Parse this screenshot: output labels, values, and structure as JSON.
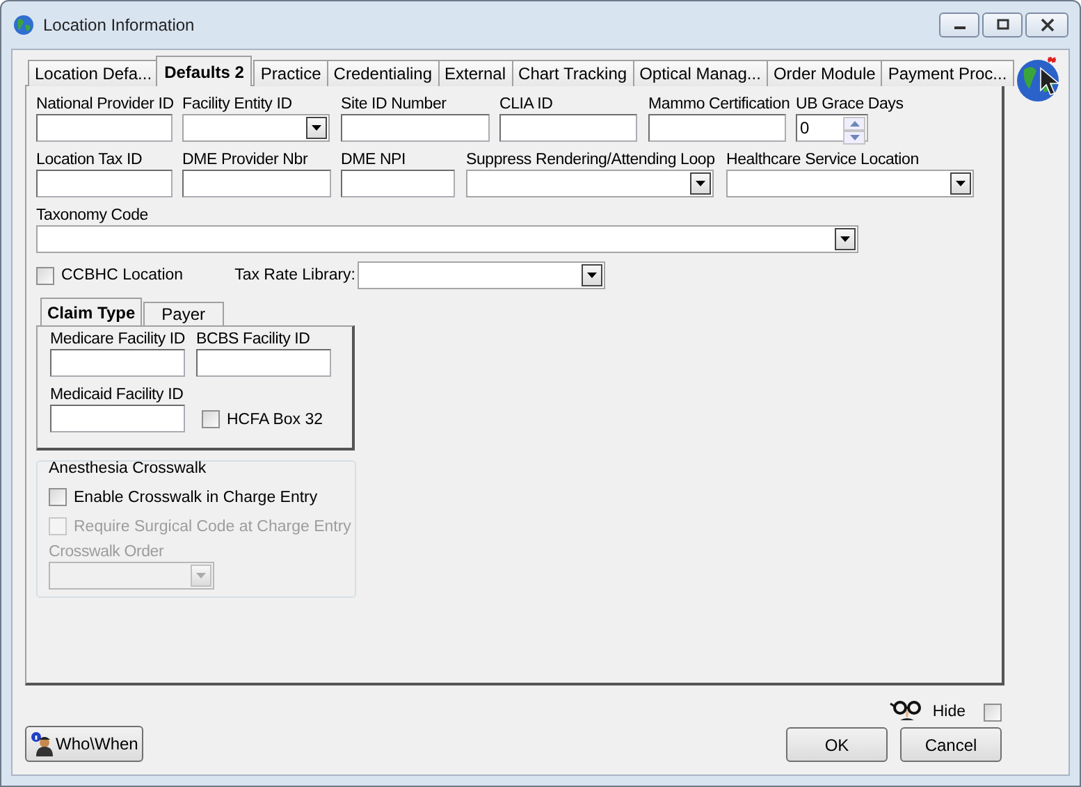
{
  "window": {
    "title": "Location Information"
  },
  "tabs": [
    {
      "label": "Location Defa...",
      "selected": false
    },
    {
      "label": "Defaults 2",
      "selected": true
    },
    {
      "label": "Practice",
      "selected": false
    },
    {
      "label": "Credentialing",
      "selected": false
    },
    {
      "label": "External",
      "selected": false
    },
    {
      "label": "Chart Tracking",
      "selected": false
    },
    {
      "label": "Optical Manag...",
      "selected": false
    },
    {
      "label": "Order Module",
      "selected": false
    },
    {
      "label": "Payment Proc...",
      "selected": false
    }
  ],
  "rows": [
    [
      {
        "kind": "text",
        "label": "National Provider ID"
      },
      {
        "kind": "combo",
        "label": "Facility Entity ID"
      },
      {
        "kind": "text",
        "label": "Site ID Number"
      },
      {
        "kind": "text",
        "label": "CLIA ID"
      },
      {
        "kind": "text",
        "label": "Mammo Certification"
      },
      {
        "kind": "spinner",
        "label": "UB Grace Days",
        "value": "0"
      }
    ],
    [
      {
        "kind": "text",
        "label": "Location Tax ID"
      },
      {
        "kind": "text",
        "label": "DME Provider Nbr"
      },
      {
        "kind": "text",
        "label": "DME NPI"
      },
      {
        "kind": "combo",
        "label": "Suppress Rendering/Attending Loop"
      },
      {
        "kind": "combo",
        "label": "Healthcare Service Location"
      }
    ],
    [
      {
        "kind": "combo",
        "label": "Taxonomy Code"
      }
    ]
  ],
  "ccbhc": {
    "label": "CCBHC Location",
    "checked": false
  },
  "tax_rate": {
    "label": "Tax Rate Library:"
  },
  "subtabs": [
    {
      "label": "Claim Type",
      "selected": true
    },
    {
      "label": "Payer",
      "selected": false
    }
  ],
  "claim_type": {
    "fields": [
      {
        "kind": "text",
        "label": "Medicare Facility ID"
      },
      {
        "kind": "text",
        "label": "BCBS Facility ID"
      },
      {
        "kind": "text",
        "label": "Medicaid Facility ID"
      },
      {
        "kind": "checkbox",
        "label": "HCFA Box 32",
        "checked": false
      }
    ]
  },
  "anesthesia": {
    "title": "Anesthesia Crosswalk",
    "options": [
      {
        "label": "Enable Crosswalk in Charge Entry",
        "checked": false,
        "disabled": false
      },
      {
        "label": "Require Surgical Code at Charge Entry",
        "checked": false,
        "disabled": true
      }
    ],
    "order": {
      "label": "Crosswalk Order",
      "disabled": true
    }
  },
  "hide": {
    "label": "Hide",
    "checked": false
  },
  "buttons": {
    "who_when": "Who\\When",
    "ok": "OK",
    "cancel": "Cancel"
  }
}
